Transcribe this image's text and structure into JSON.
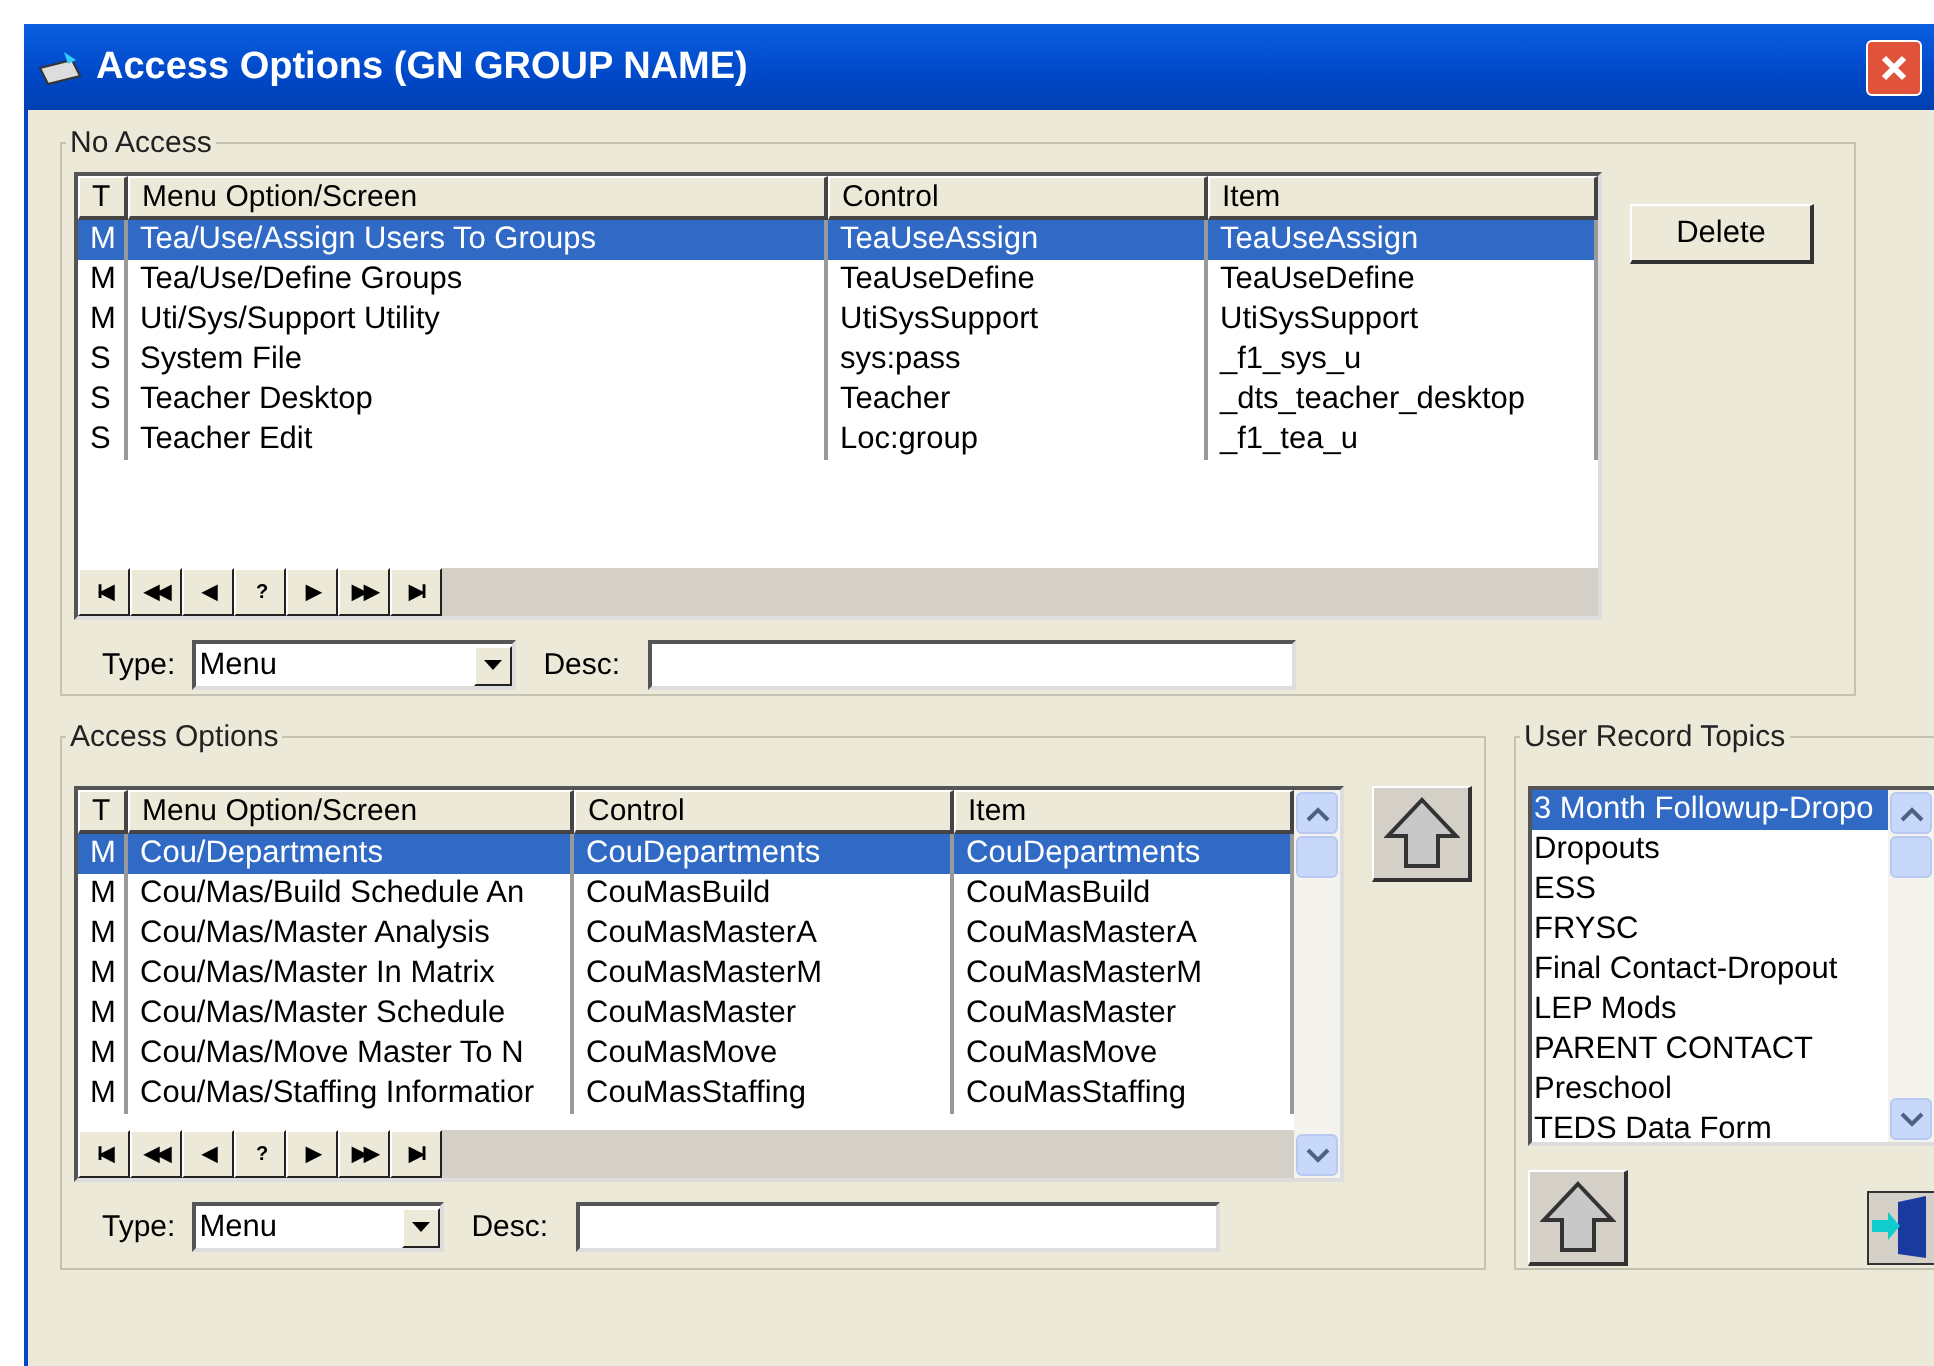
{
  "window": {
    "title": "Access Options (GN GROUP NAME)"
  },
  "no_access": {
    "title": "No Access",
    "columns": [
      "T",
      "Menu Option/Screen",
      "Control",
      "Item"
    ],
    "rows": [
      {
        "cells": [
          "M",
          "Tea/Use/Assign Users To Groups",
          "TeaUseAssign",
          "TeaUseAssign"
        ],
        "selected": true
      },
      {
        "cells": [
          "M",
          "Tea/Use/Define Groups",
          "TeaUseDefine",
          "TeaUseDefine"
        ],
        "selected": false
      },
      {
        "cells": [
          "M",
          "Uti/Sys/Support Utility",
          "UtiSysSupport",
          "UtiSysSupport"
        ],
        "selected": false
      },
      {
        "cells": [
          "S",
          "System File",
          "sys:pass",
          "_f1_sys_u"
        ],
        "selected": false
      },
      {
        "cells": [
          "S",
          "Teacher Desktop",
          "Teacher",
          "_dts_teacher_desktop"
        ],
        "selected": false
      },
      {
        "cells": [
          "S",
          "Teacher Edit",
          "Loc:group",
          "_f1_tea_u"
        ],
        "selected": false
      }
    ],
    "nav": [
      "I◀",
      "◀◀",
      "◀",
      "?",
      "▶",
      "▶▶",
      "▶I"
    ],
    "type_label": "Type:",
    "type_value": "Menu",
    "desc_label": "Desc:"
  },
  "delete_button": "Delete",
  "access_options": {
    "title": "Access Options",
    "columns": [
      "T",
      "Menu Option/Screen",
      "Control",
      "Item"
    ],
    "rows": [
      {
        "cells": [
          "M",
          "Cou/Departments",
          "CouDepartments",
          "CouDepartments"
        ],
        "selected": true
      },
      {
        "cells": [
          "M",
          "Cou/Mas/Build Schedule An",
          "CouMasBuild",
          "CouMasBuild"
        ],
        "selected": false
      },
      {
        "cells": [
          "M",
          "Cou/Mas/Master Analysis",
          "CouMasMasterA",
          "CouMasMasterA"
        ],
        "selected": false
      },
      {
        "cells": [
          "M",
          "Cou/Mas/Master In Matrix",
          "CouMasMasterM",
          "CouMasMasterM"
        ],
        "selected": false
      },
      {
        "cells": [
          "M",
          "Cou/Mas/Master Schedule",
          "CouMasMaster",
          "CouMasMaster"
        ],
        "selected": false
      },
      {
        "cells": [
          "M",
          "Cou/Mas/Move Master To N",
          "CouMasMove",
          "CouMasMove"
        ],
        "selected": false
      },
      {
        "cells": [
          "M",
          "Cou/Mas/Staffing Informatior",
          "CouMasStaffing",
          "CouMasStaffing"
        ],
        "selected": false
      }
    ],
    "nav": [
      "I◀",
      "◀◀",
      "◀",
      "?",
      "▶",
      "▶▶",
      "▶I"
    ],
    "type_label": "Type:",
    "type_value": "Menu",
    "desc_label": "Desc:"
  },
  "user_record_topics": {
    "title": "User Record Topics",
    "items": [
      {
        "label": "3 Month Followup-Dropo",
        "selected": true
      },
      {
        "label": "Dropouts",
        "selected": false
      },
      {
        "label": "ESS",
        "selected": false
      },
      {
        "label": "FRYSC",
        "selected": false
      },
      {
        "label": "Final Contact-Dropout",
        "selected": false
      },
      {
        "label": "LEP Mods",
        "selected": false
      },
      {
        "label": "PARENT CONTACT",
        "selected": false
      },
      {
        "label": "Preschool",
        "selected": false
      },
      {
        "label": "TEDS Data Form",
        "selected": false
      }
    ]
  }
}
